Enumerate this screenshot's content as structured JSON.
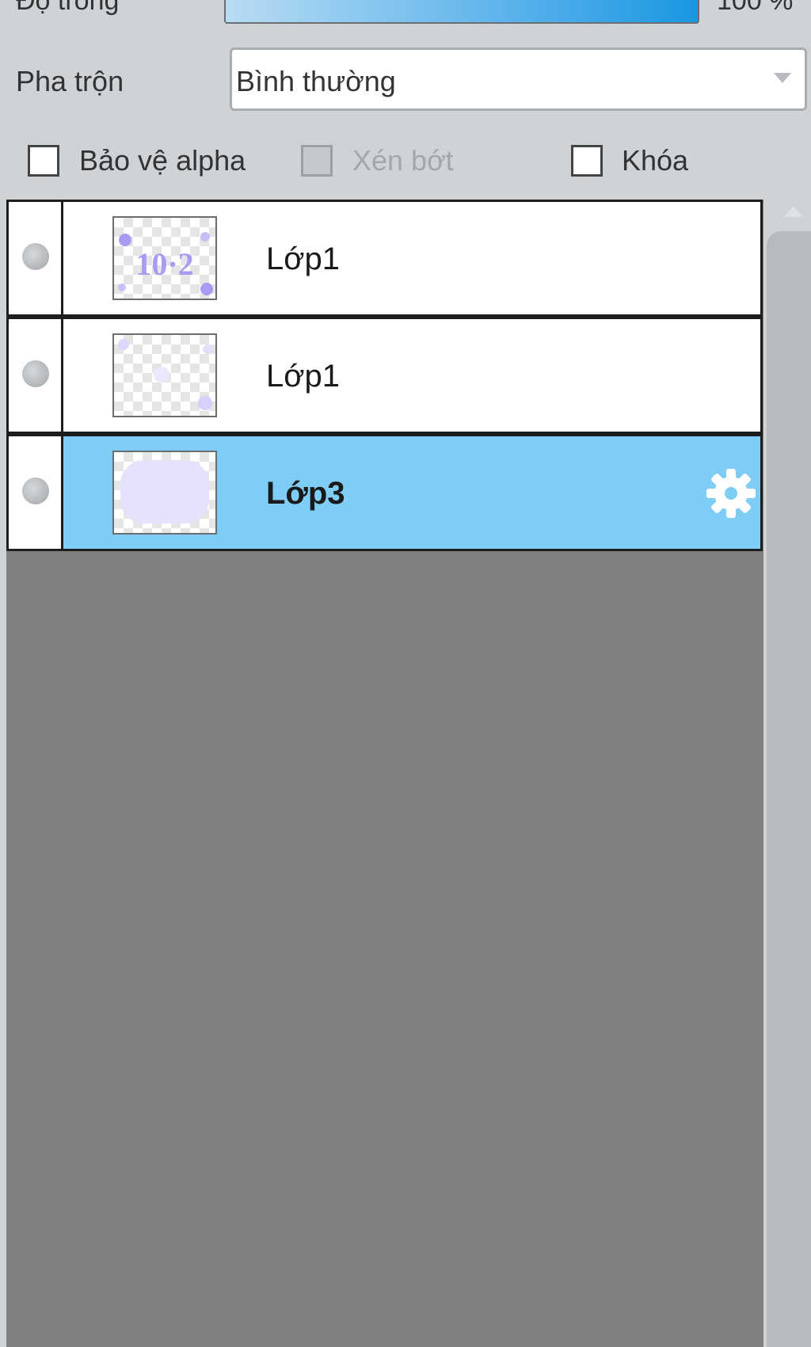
{
  "opacity": {
    "label": "Độ trong",
    "value": "100 %",
    "level": 1.0
  },
  "blend": {
    "label": "Pha trộn",
    "value": "Bình thường"
  },
  "options": {
    "alpha_protect": {
      "label": "Bảo vệ alpha",
      "checked": false,
      "enabled": true
    },
    "clipping": {
      "label": "Xén bớt",
      "checked": false,
      "enabled": false
    },
    "lock": {
      "label": "Khóa",
      "checked": false,
      "enabled": true
    }
  },
  "layers": [
    {
      "name": "Lớp1",
      "thumbnail_text": "10·2",
      "selected": false
    },
    {
      "name": "Lớp1",
      "selected": false
    },
    {
      "name": "Lớp3",
      "selected": true
    }
  ],
  "colors": {
    "selected_row": "#7ecdf5",
    "list_background": "#808080",
    "panel_background": "#cfd3d6",
    "thumbnail_ink": "#a79cf2"
  },
  "icons": [
    "visibility-dot-icon",
    "gear-icon",
    "dropdown-arrow-icon",
    "scroll-up-arrow-icon"
  ]
}
